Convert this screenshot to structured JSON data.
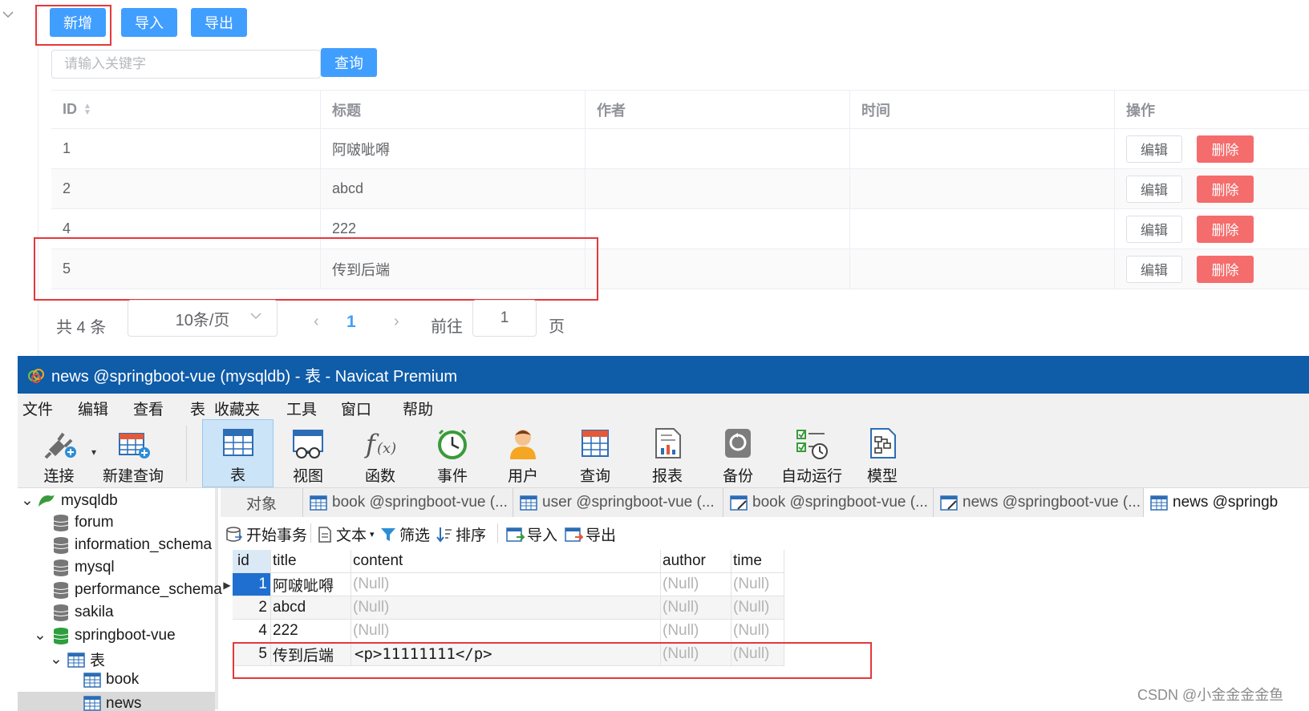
{
  "web": {
    "toolbar": {
      "add": "新增",
      "import": "导入",
      "export": "导出"
    },
    "search": {
      "placeholder": "请输入关键字",
      "button": "查询"
    },
    "table": {
      "headers": [
        "ID",
        "标题",
        "作者",
        "时间",
        "操作"
      ],
      "rows": [
        {
          "id": "1",
          "title": "阿啵呲嘚",
          "author": "",
          "time": ""
        },
        {
          "id": "2",
          "title": "abcd",
          "author": "",
          "time": ""
        },
        {
          "id": "4",
          "title": "222",
          "author": "",
          "time": ""
        },
        {
          "id": "5",
          "title": "传到后端",
          "author": "",
          "time": ""
        }
      ],
      "edit_label": "编辑",
      "delete_label": "删除"
    },
    "pagination": {
      "total": "共 4 条",
      "page_size": "10条/页",
      "current": "1",
      "goto": "前往",
      "goto_value": "1",
      "page_suffix": "页"
    }
  },
  "navicat": {
    "title": "news @springboot-vue (mysqldb) - 表 - Navicat Premium",
    "menu": [
      "文件",
      "编辑",
      "查看",
      "表",
      "收藏夹",
      "工具",
      "窗口",
      "帮助"
    ],
    "toolbar": [
      "连接",
      "新建查询",
      "表",
      "视图",
      "函数",
      "事件",
      "用户",
      "查询",
      "报表",
      "备份",
      "自动运行",
      "模型"
    ],
    "tree": {
      "connection": "mysqldb",
      "databases": [
        "forum",
        "information_schema",
        "mysql",
        "performance_schema",
        "sakila",
        "springboot-vue"
      ],
      "tables_label": "表",
      "tables": [
        "book",
        "news"
      ]
    },
    "tabs": [
      "对象",
      "book @springboot-vue (...",
      "user @springboot-vue (...",
      "book @springboot-vue (...",
      "news @springboot-vue (...",
      "news @springb"
    ],
    "subtoolbar": {
      "begin_tx": "开始事务",
      "text": "文本",
      "filter": "筛选",
      "sort": "排序",
      "import": "导入",
      "export": "导出"
    },
    "grid": {
      "columns": [
        "id",
        "title",
        "content",
        "author",
        "time"
      ],
      "rows": [
        {
          "id": "1",
          "title": "阿啵呲嘚",
          "content": "(Null)",
          "author": "(Null)",
          "time": "(Null)"
        },
        {
          "id": "2",
          "title": "abcd",
          "content": "(Null)",
          "author": "(Null)",
          "time": "(Null)"
        },
        {
          "id": "4",
          "title": "222",
          "content": "(Null)",
          "author": "(Null)",
          "time": "(Null)"
        },
        {
          "id": "5",
          "title": "传到后端",
          "content": "<p>11111111</p>",
          "author": "(Null)",
          "time": "(Null)"
        }
      ]
    }
  },
  "watermark": "CSDN @小金金金金鱼",
  "colors": {
    "primary": "#409eff",
    "danger": "#f56c6c",
    "highlight": "#e5383b",
    "navicat_title": "#0f5ca8"
  }
}
